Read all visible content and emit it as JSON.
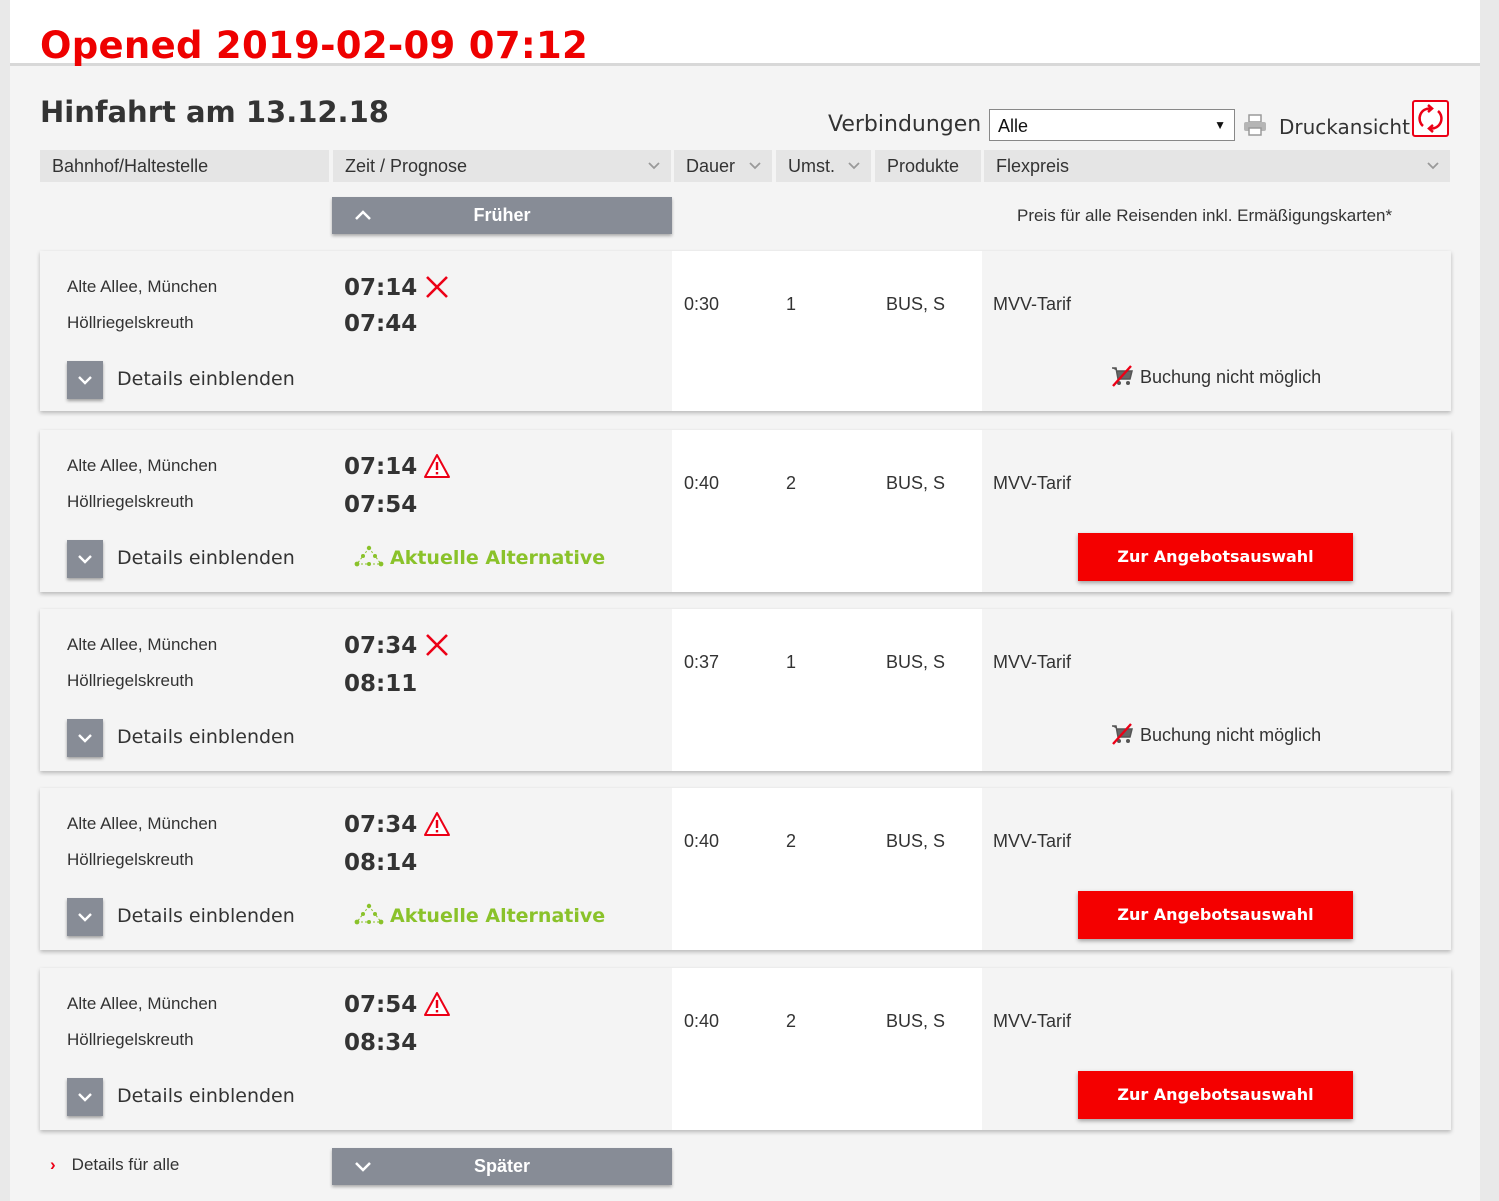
{
  "stamp": "Opened 2019-02-09 07:12",
  "heading": "Hinfahrt am 13.12.18",
  "controls": {
    "connections_label": "Verbindungen",
    "connections_value": "Alle",
    "print_label": "Druckansicht"
  },
  "columns": {
    "station": "Bahnhof/Haltestelle",
    "time": "Zeit / Prognose",
    "duration": "Dauer",
    "transfers": "Umst.",
    "products": "Produkte",
    "price": "Flexpreis"
  },
  "nav": {
    "earlier": "Früher",
    "later": "Später"
  },
  "price_note": "Preis für alle Reisenden inkl. Ermäßigungskarten*",
  "details_label": "Details einblenden",
  "details_all": "Details für alle",
  "alternative_label": "Aktuelle Alternative",
  "no_booking_label": "Buchung nicht möglich",
  "offer_label": "Zur Angebotsauswahl",
  "connections": [
    {
      "from": "Alte Allee, München",
      "to": "Höllriegelskreuth",
      "dep": "07:14",
      "arr": "07:44",
      "duration": "0:30",
      "transfers": "1",
      "products": "BUS, S",
      "tariff": "MVV-Tarif",
      "status_icon": "cancelled-icon",
      "alternative": false,
      "bookable": false
    },
    {
      "from": "Alte Allee, München",
      "to": "Höllriegelskreuth",
      "dep": "07:14",
      "arr": "07:54",
      "duration": "0:40",
      "transfers": "2",
      "products": "BUS, S",
      "tariff": "MVV-Tarif",
      "status_icon": "warning-icon",
      "alternative": true,
      "bookable": true
    },
    {
      "from": "Alte Allee, München",
      "to": "Höllriegelskreuth",
      "dep": "07:34",
      "arr": "08:11",
      "duration": "0:37",
      "transfers": "1",
      "products": "BUS, S",
      "tariff": "MVV-Tarif",
      "status_icon": "cancelled-icon",
      "alternative": false,
      "bookable": false
    },
    {
      "from": "Alte Allee, München",
      "to": "Höllriegelskreuth",
      "dep": "07:34",
      "arr": "08:14",
      "duration": "0:40",
      "transfers": "2",
      "products": "BUS, S",
      "tariff": "MVV-Tarif",
      "status_icon": "warning-icon",
      "alternative": true,
      "bookable": true
    },
    {
      "from": "Alte Allee, München",
      "to": "Höllriegelskreuth",
      "dep": "07:54",
      "arr": "08:34",
      "duration": "0:40",
      "transfers": "2",
      "products": "BUS, S",
      "tariff": "MVV-Tarif",
      "status_icon": "warning-icon",
      "alternative": false,
      "bookable": true
    }
  ],
  "colors": {
    "brand_red": "#ec0016",
    "offer_red": "#f40000",
    "alt_green": "#8ac22a",
    "button_grey": "#878c96"
  }
}
